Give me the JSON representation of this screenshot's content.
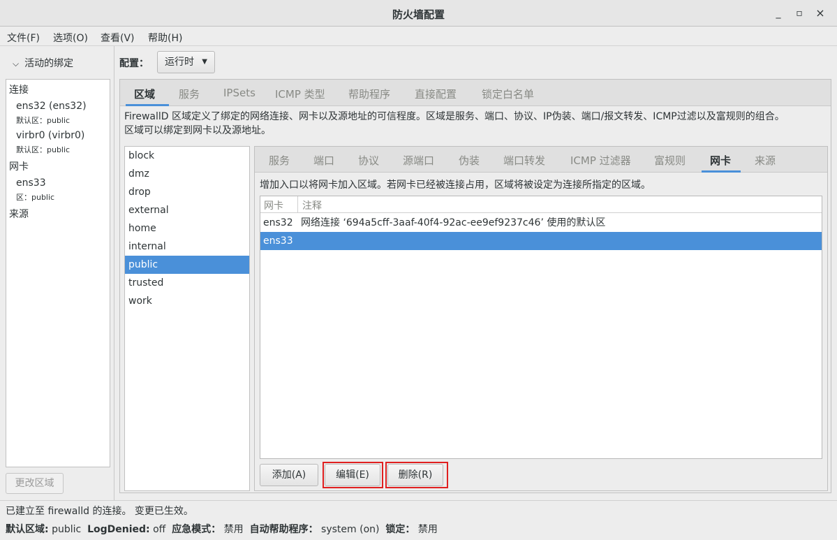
{
  "window": {
    "title": "防火墙配置",
    "minimize_glyph": "_",
    "maximize_glyph": "▫",
    "close_glyph": "×"
  },
  "menubar": {
    "file": "文件(F)",
    "options": "选项(O)",
    "view": "查看(V)",
    "help": "帮助(H)"
  },
  "left_pane": {
    "header": "活动的绑定",
    "connections_label": "连接",
    "connections": [
      {
        "name": "ens32 (ens32)",
        "zone": "默认区：public"
      },
      {
        "name": "virbr0 (virbr0)",
        "zone": "默认区：public"
      }
    ],
    "interfaces_label": "网卡",
    "interfaces": [
      {
        "name": "ens33",
        "zone": "区：public"
      }
    ],
    "sources_label": "来源",
    "change_zone_button": "更改区域"
  },
  "config": {
    "label": "配置：",
    "selected": "运行时"
  },
  "main_tabs": [
    "区域",
    "服务",
    "IPSets",
    "ICMP 类型",
    "帮助程序",
    "直接配置",
    "锁定白名单"
  ],
  "active_main_tab": "区域",
  "zone_description_line1": "FirewallD 区域定义了绑定的网络连接、网卡以及源地址的可信程度。区域是服务、端口、协议、IP伪装、端口/报文转发、ICMP过滤以及富规则的组合。",
  "zone_description_line2": "区域可以绑定到网卡以及源地址。",
  "zones": [
    "block",
    "dmz",
    "drop",
    "external",
    "home",
    "internal",
    "public",
    "trusted",
    "work"
  ],
  "selected_zone": "public",
  "sub_tabs": [
    "服务",
    "端口",
    "协议",
    "源端口",
    "伪装",
    "端口转发",
    "ICMP 过滤器",
    "富规则",
    "网卡",
    "来源"
  ],
  "active_sub_tab": "网卡",
  "interfaces_tab": {
    "hint": "增加入口以将网卡加入区域。若网卡已经被连接占用，区域将被设定为连接所指定的区域。",
    "columns": [
      "网卡",
      "注释"
    ],
    "rows": [
      {
        "iface": "ens32",
        "comment": "网络连接 ‘694a5cff-3aaf-40f4-92ac-ee9ef9237c46’ 使用的默认区"
      },
      {
        "iface": "ens33",
        "comment": ""
      }
    ],
    "selected_row": "ens33",
    "add_button": "添加(A)",
    "edit_button": "编辑(E)",
    "remove_button": "删除(R)"
  },
  "status": {
    "line1": "已建立至 firewalld 的连接。 变更已生效。",
    "default_zone_label": "默认区域:",
    "default_zone_value": "public",
    "log_denied_label": "LogDenied:",
    "log_denied_value": "off",
    "panic_label": "应急模式：",
    "panic_value": "禁用",
    "auto_helper_label": "自动帮助程序：",
    "auto_helper_value": "system (on)",
    "lockdown_label": "锁定：",
    "lockdown_value": "禁用"
  },
  "colors": {
    "accent": "#4a90d9",
    "highlight_box": "#e02020"
  }
}
